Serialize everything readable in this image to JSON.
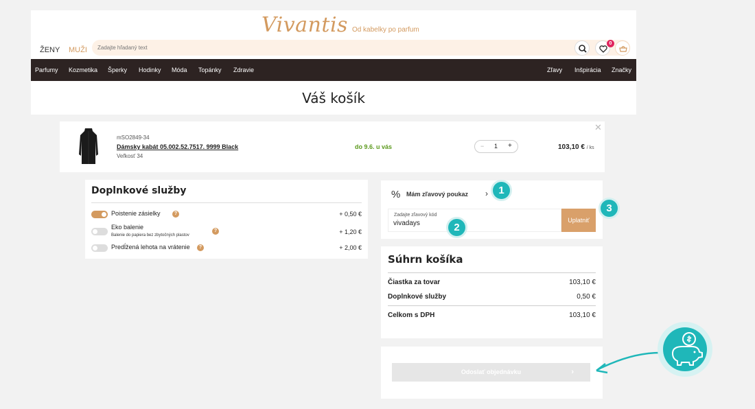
{
  "brand": {
    "logo": "Vivantis",
    "tagline": "Od kabelky po parfum",
    "accent": "#d39a5f",
    "nav_bg": "#2d2322",
    "teal": "#1fb7b9"
  },
  "gender_tabs": [
    "ŽENY",
    "MUŽI"
  ],
  "search": {
    "placeholder": "Zadajte hľadaný text",
    "icon": "search-icon"
  },
  "header_icons": {
    "wishlist_count": "0",
    "wishlist": "heart-icon",
    "cart": "basket-icon"
  },
  "nav": {
    "left": [
      "Parfumy",
      "Kozmetika",
      "Šperky",
      "Hodinky",
      "Móda",
      "Topánky",
      "Zdravie"
    ],
    "right": [
      "Zľavy",
      "Inšpirácia",
      "Značky"
    ]
  },
  "page_title": "Váš košík",
  "cart_item": {
    "sku": "mSO2849-34",
    "name": "Dámsky kabát 05.002.52.7517. 9999 Black",
    "size": "Veľkosť 34",
    "delivery": "do 9.6. u vás",
    "qty_minus": "−",
    "qty": "1",
    "qty_plus": "+",
    "price": "103,10 €",
    "per_unit": "/ ks",
    "remove": "✕"
  },
  "services": {
    "title": "Doplnkové služby",
    "items": [
      {
        "label": "Poistenie zásielky",
        "sub": "",
        "price": "+ 0,50 €",
        "enabled": true
      },
      {
        "label": "Eko balenie",
        "sub": "Balenie do papiera bez zbytočných plastov",
        "price": "+ 1,20 €",
        "enabled": false
      },
      {
        "label": "Predĺžená lehota na vrátenie",
        "sub": "",
        "price": "+ 2,00 €",
        "enabled": false
      }
    ],
    "help": "?"
  },
  "voucher": {
    "percent": "%",
    "label": "Mám zľavový poukaz",
    "chevron": "›",
    "field_label": "Zadajte zľavový kód",
    "value": "vivadays",
    "apply": "Uplatniť"
  },
  "summary": {
    "title": "Súhrn košíka",
    "rows": [
      {
        "label": "Čiastka za tovar",
        "value": "103,10 €"
      },
      {
        "label": "Doplnkové služby",
        "value": "0,50 €"
      },
      {
        "label": "Celkom s DPH",
        "value": "103,10 €"
      }
    ]
  },
  "order_button": {
    "label": "Odoslať objednávku",
    "chevron": "›"
  },
  "steps": [
    "1",
    "2",
    "3"
  ]
}
